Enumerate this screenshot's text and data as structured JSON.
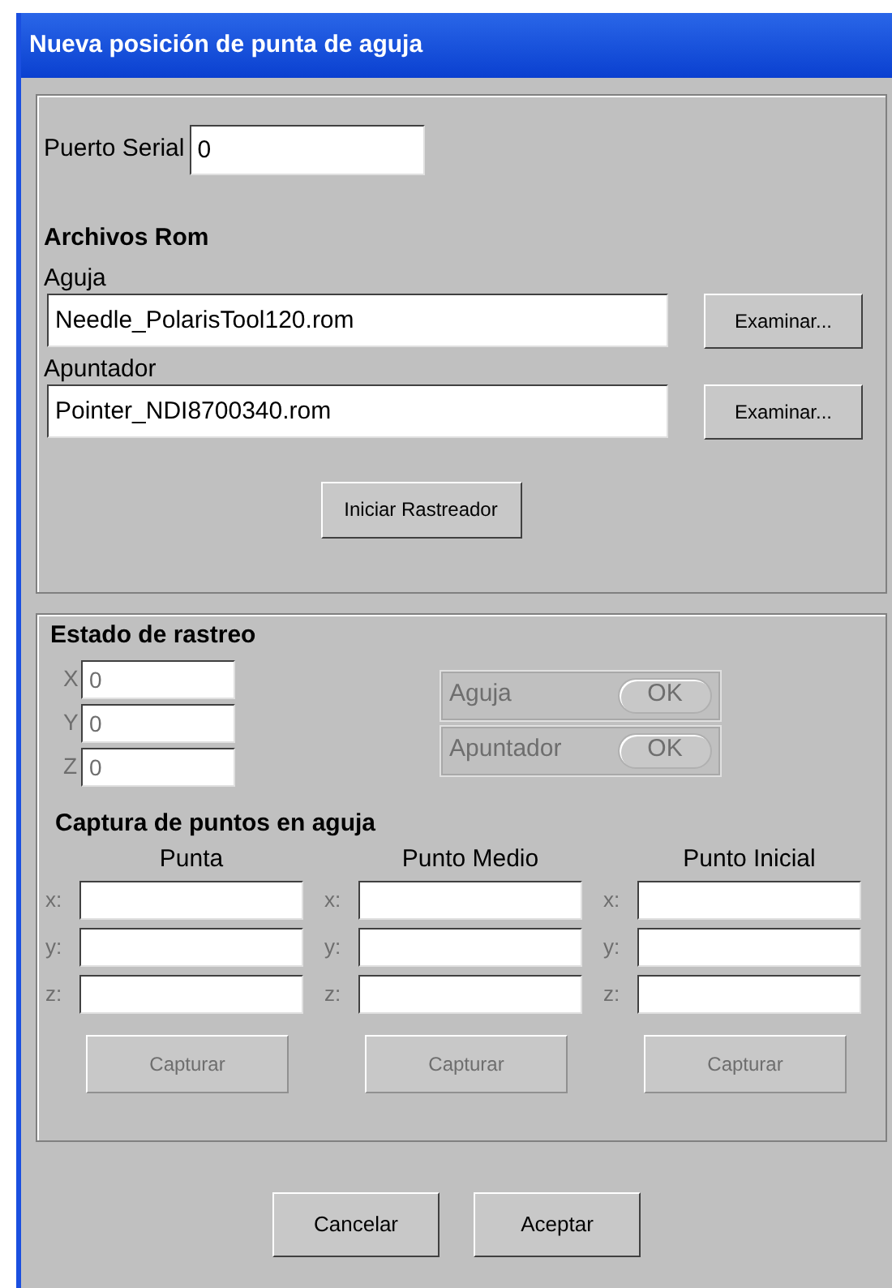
{
  "window": {
    "title": "Nueva posición de punta de aguja"
  },
  "connection": {
    "port_label": "Puerto Serial",
    "port_value": "0"
  },
  "rom_files": {
    "heading": "Archivos Rom",
    "files": [
      {
        "label": "Aguja",
        "value": "Needle_PolarisTool120.rom",
        "button": "Examinar..."
      },
      {
        "label": "Apuntador",
        "value": "Pointer_NDI8700340.rom",
        "button": "Examinar..."
      }
    ],
    "start_button": "Iniciar Rastreador"
  },
  "tracking": {
    "heading": "Estado de rastreo",
    "coords": [
      {
        "label": "X",
        "value": "0",
        "disabled": true
      },
      {
        "label": "Y",
        "value": "0",
        "disabled": true
      },
      {
        "label": "Z",
        "value": "0",
        "disabled": true
      }
    ],
    "tools": [
      {
        "label": "Aguja",
        "status": "OK",
        "disabled": true
      },
      {
        "label": "Apuntador",
        "status": "OK",
        "disabled": true
      }
    ]
  },
  "capture": {
    "heading": "Captura de puntos en aguja",
    "groups": [
      {
        "title": "Punta",
        "fields": [
          "x:",
          "y:",
          "z:"
        ],
        "button": "Capturar",
        "disabled": true
      },
      {
        "title": "Punto Medio",
        "fields": [
          "x:",
          "y:",
          "z:"
        ],
        "button": "Capturar",
        "disabled": true
      },
      {
        "title": "Punto Inicial",
        "fields": [
          "x:",
          "y:",
          "z:"
        ],
        "button": "Capturar",
        "disabled": true
      }
    ]
  },
  "buttons": [
    "Cancelar",
    "Aceptar"
  ]
}
